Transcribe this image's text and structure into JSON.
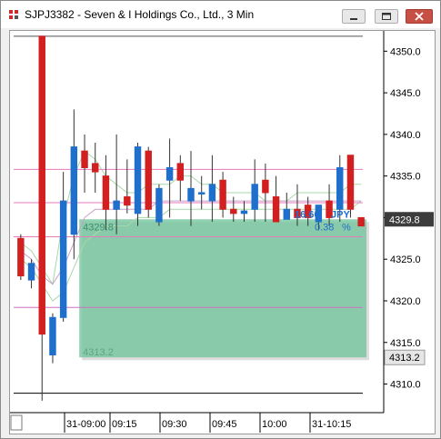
{
  "window": {
    "title": "SJPJ3382 - Seven & I Holdings Co., Ltd., 3 Min",
    "buttons": [
      "minimize",
      "restore",
      "close"
    ]
  },
  "icons": {
    "app": "bar-chart-icon",
    "minimize": "minimize-icon",
    "restore": "restore-icon",
    "close": "close-icon"
  },
  "colors": {
    "up": "#1f6fcc",
    "down": "#d21f1f",
    "shade_fill": "#74c69d",
    "guide_pink": "#e87ab8",
    "ribbon": "#a8d8a8"
  },
  "price_axis": {
    "ticks": [
      "4350.0",
      "4345.0",
      "4340.0",
      "4335.0",
      "4330.0",
      "4325.0",
      "4320.0",
      "4315.0",
      "4310.0"
    ],
    "tick_values": [
      4350,
      4345,
      4340,
      4335,
      4330,
      4325,
      4320,
      4315,
      4310
    ],
    "last_price_label": "4329.8",
    "last_price": 4329.8,
    "anchor_label": "4313.2",
    "anchor_price": 4313.2
  },
  "time_axis": {
    "labels": [
      "31-09:00",
      "09:15",
      "09:30",
      "09:45",
      "10:00",
      "31-10:15"
    ]
  },
  "annotations": {
    "upper_price": "4329.8",
    "lower_price": "4313.2",
    "change_points": "16.60",
    "change_unit": "JPY",
    "change_percent": "0.38",
    "percent_sign": "%"
  },
  "chart_data": {
    "type": "candlestick",
    "ylim": [
      4307,
      4352
    ],
    "bars": [
      {
        "o": 4327.5,
        "h": 4328.0,
        "l": 4322.5,
        "c": 4323.0
      },
      {
        "o": 4322.5,
        "h": 4325.0,
        "l": 4321.5,
        "c": 4324.5
      },
      {
        "o": 4351.8,
        "h": 4351.8,
        "l": 4308.0,
        "c": 4316.0
      },
      {
        "o": 4313.5,
        "h": 4318.5,
        "l": 4312.5,
        "c": 4318.0
      },
      {
        "o": 4318.0,
        "h": 4335.5,
        "l": 4317.5,
        "c": 4332.0
      },
      {
        "o": 4328.0,
        "h": 4343.0,
        "l": 4325.0,
        "c": 4338.5
      },
      {
        "o": 4338.0,
        "h": 4340.0,
        "l": 4333.0,
        "c": 4336.0
      },
      {
        "o": 4336.5,
        "h": 4339.0,
        "l": 4333.0,
        "c": 4335.5
      },
      {
        "o": 4335.0,
        "h": 4337.5,
        "l": 4328.5,
        "c": 4331.0
      },
      {
        "o": 4331.0,
        "h": 4340.0,
        "l": 4328.0,
        "c": 4332.0
      },
      {
        "o": 4332.5,
        "h": 4337.0,
        "l": 4330.5,
        "c": 4331.5
      },
      {
        "o": 4330.5,
        "h": 4339.0,
        "l": 4329.0,
        "c": 4338.5
      },
      {
        "o": 4338.0,
        "h": 4338.5,
        "l": 4330.0,
        "c": 4331.0
      },
      {
        "o": 4329.5,
        "h": 4334.0,
        "l": 4329.0,
        "c": 4333.5
      },
      {
        "o": 4334.5,
        "h": 4339.5,
        "l": 4330.0,
        "c": 4336.0
      },
      {
        "o": 4336.5,
        "h": 4337.5,
        "l": 4332.0,
        "c": 4334.5
      },
      {
        "o": 4332.0,
        "h": 4338.0,
        "l": 4329.0,
        "c": 4333.5
      },
      {
        "o": 4333.0,
        "h": 4335.0,
        "l": 4331.0,
        "c": 4333.0
      },
      {
        "o": 4332.0,
        "h": 4337.5,
        "l": 4329.5,
        "c": 4334.0
      },
      {
        "o": 4334.5,
        "h": 4335.5,
        "l": 4330.0,
        "c": 4331.0
      },
      {
        "o": 4331.0,
        "h": 4332.5,
        "l": 4329.5,
        "c": 4330.5
      },
      {
        "o": 4330.5,
        "h": 4332.0,
        "l": 4329.5,
        "c": 4330.8
      },
      {
        "o": 4331.0,
        "h": 4337.0,
        "l": 4329.5,
        "c": 4334.0
      },
      {
        "o": 4334.5,
        "h": 4336.5,
        "l": 4329.5,
        "c": 4333.0
      },
      {
        "o": 4332.5,
        "h": 4335.0,
        "l": 4329.5,
        "c": 4329.5
      },
      {
        "o": 4329.8,
        "h": 4333.0,
        "l": 4330.0,
        "c": 4331.0
      },
      {
        "o": 4331.0,
        "h": 4334.0,
        "l": 4329.0,
        "c": 4330.0
      },
      {
        "o": 4331.5,
        "h": 4332.5,
        "l": 4329.0,
        "c": 4330.0
      },
      {
        "o": 4329.5,
        "h": 4331.0,
        "l": 4328.5,
        "c": 4331.5
      },
      {
        "o": 4332.0,
        "h": 4334.0,
        "l": 4329.0,
        "c": 4330.0
      },
      {
        "o": 4331.0,
        "h": 4337.5,
        "l": 4329.5,
        "c": 4336.0
      },
      {
        "o": 4337.5,
        "h": 4337.5,
        "l": 4330.0,
        "c": 4331.0
      },
      {
        "o": 4330.0,
        "h": 4330.0,
        "l": 4329.0,
        "c": 4329.0
      }
    ],
    "bands": {
      "ribbon_upper": [
        4327,
        4326,
        4324,
        4322,
        4330,
        4335,
        4338,
        4337,
        4335,
        4334,
        4333,
        4333,
        4334,
        4334,
        4334,
        4335,
        4335,
        4334,
        4334,
        4333,
        4333,
        4333,
        4333,
        4332,
        4332,
        4332,
        4333,
        4333,
        4333,
        4333,
        4333,
        4334,
        4334
      ],
      "ribbon_lower": [
        4325,
        4324,
        4322,
        4320,
        4321,
        4324,
        4327,
        4328,
        4329,
        4329,
        4329,
        4330,
        4330,
        4330,
        4331,
        4331,
        4331,
        4331,
        4331,
        4331,
        4331,
        4331,
        4331,
        4331,
        4331,
        4331,
        4331,
        4331,
        4331,
        4331,
        4331,
        4331,
        4332
      ],
      "ma_line": [
        4326,
        4325,
        4323,
        4322,
        4324,
        4327,
        4330,
        4331,
        4331,
        4331,
        4331,
        4331,
        4331,
        4332,
        4332,
        4332,
        4332,
        4332,
        4332,
        4332,
        4332,
        4332,
        4332,
        4332,
        4332,
        4332,
        4332,
        4332,
        4332,
        4332,
        4332,
        4332,
        4332
      ]
    },
    "horizontal_lines": [
      {
        "price": 4351.8,
        "color": "#555555"
      },
      {
        "price": 4335.8,
        "color": "#e87ab8"
      },
      {
        "price": 4331.8,
        "color": "#e87ab8"
      },
      {
        "price": 4327.7,
        "color": "#e87ab8"
      },
      {
        "price": 4319.2,
        "color": "#d070c0"
      },
      {
        "price": 4308.9,
        "color": "#000000"
      }
    ],
    "shaded_region": {
      "from_bar": 6,
      "to_bar": 32,
      "top": 4329.8,
      "bottom": 4313.2
    }
  }
}
